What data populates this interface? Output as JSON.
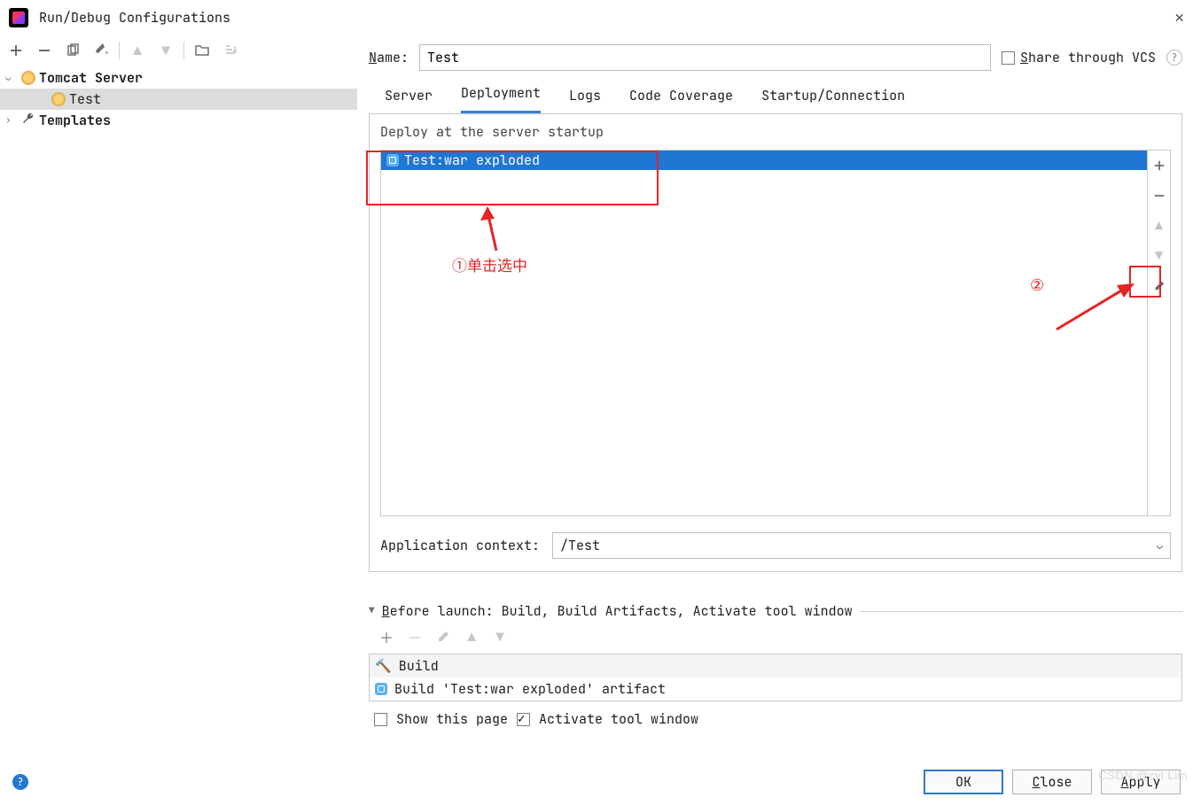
{
  "window": {
    "title": "Run/Debug Configurations"
  },
  "tree": {
    "tomcat_label": "Tomcat Server",
    "tomcat_child": "Test",
    "templates_label": "Templates"
  },
  "form": {
    "name_label_pre": "N",
    "name_label_post": "ame:",
    "name_value": "Test",
    "share_pre": "S",
    "share_post": "hare through VCS"
  },
  "tabs": {
    "server": "Server",
    "deployment": "Deployment",
    "logs": "Logs",
    "coverage": "Code Coverage",
    "startup": "Startup/Connection"
  },
  "deploy": {
    "section_title": "Deploy at the server startup",
    "item": "Test:war exploded",
    "ctx_label": "Application context:",
    "ctx_value": "/Test"
  },
  "before": {
    "header_pre": "B",
    "header_post": "efore launch: Build, Build Artifacts, Activate tool window",
    "row1": "Build",
    "row2": "Build 'Test:war exploded' artifact",
    "show_page": "Show this page",
    "activate": "Activate tool window"
  },
  "buttons": {
    "ok": "OK",
    "close_pre": "C",
    "close_post": "lose",
    "apply_pre": "A",
    "apply_post": "pply"
  },
  "annotations": {
    "one": "①单击选中",
    "two": "②"
  },
  "watermark": "CSDN @cyl Lim"
}
